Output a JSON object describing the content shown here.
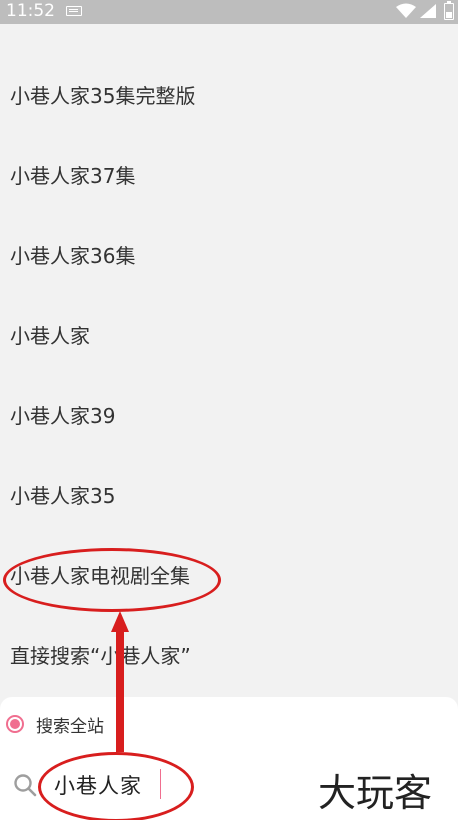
{
  "status_bar": {
    "time": "11:52",
    "icons": [
      "keyboard-icon",
      "wifi-icon",
      "signal-icon",
      "battery-icon"
    ]
  },
  "suggestions": [
    {
      "label": "小巷人家35集完整版"
    },
    {
      "label": "小巷人家37集"
    },
    {
      "label": "小巷人家36集"
    },
    {
      "label": "小巷人家"
    },
    {
      "label": "小巷人家39"
    },
    {
      "label": "小巷人家35"
    },
    {
      "label": "小巷人家电视剧全集"
    },
    {
      "label": "直接搜索“小巷人家”"
    }
  ],
  "search_panel": {
    "scope_label": "搜索全站",
    "query": "小巷人家"
  },
  "watermark": {
    "text": "大玩客"
  },
  "colors": {
    "accent": "#f06e8f",
    "annotation": "#d81e1e",
    "list_background": "#f2f2f2",
    "status_bar": "#bdbdbd"
  }
}
